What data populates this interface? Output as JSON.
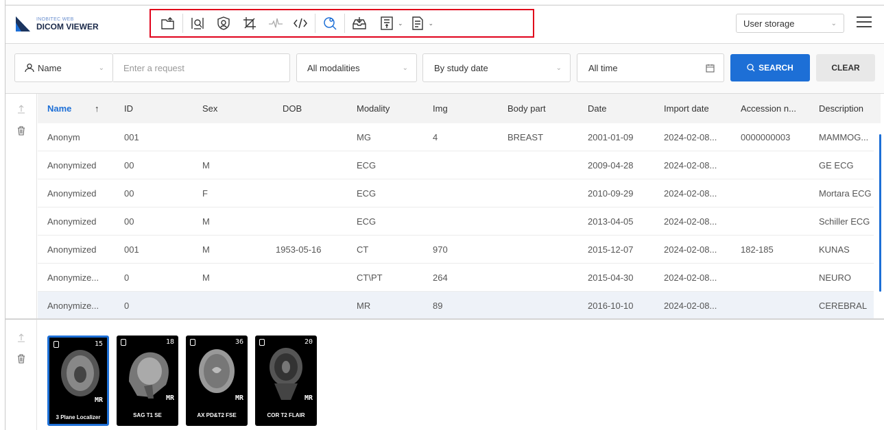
{
  "app": {
    "logo_small": "INOBITEC WEB",
    "logo_big": "DICOM VIEWER",
    "brand_color": "#1d6fd6",
    "highlight_color": "#e0001a"
  },
  "toolbar": {
    "icons": [
      "open-folder-icon",
      "search-image-icon",
      "anonymize-shield-icon",
      "crop-edit-icon",
      "ecg-wave-icon",
      "code-icon",
      "search-settings-icon",
      "download-tray-icon",
      "export-series-icon",
      "report-icon"
    ],
    "caret": "⌄"
  },
  "header": {
    "storage_value": "User storage",
    "caret": "⌄"
  },
  "search": {
    "field_selector": "Name",
    "request_placeholder": "Enter a request",
    "modality_value": "All modalities",
    "date_type_value": "By study date",
    "period_value": "All time",
    "search_label": "SEARCH",
    "clear_label": "CLEAR",
    "caret": "⌄"
  },
  "table": {
    "sort_arrow": "↑",
    "columns": [
      "Name",
      "ID",
      "Sex",
      "DOB",
      "Modality",
      "Img",
      "Body part",
      "Date",
      "Import date",
      "Accession n...",
      "Description"
    ],
    "rows": [
      [
        "Anonym",
        "001",
        "",
        "",
        "MG",
        "4",
        "BREAST",
        "2001-01-09",
        "2024-02-08...",
        "0000000003",
        "MAMMOG..."
      ],
      [
        "Anonymized",
        "00",
        "M",
        "",
        "ECG",
        "",
        "",
        "2009-04-28",
        "2024-02-08...",
        "",
        "GE ECG"
      ],
      [
        "Anonymized",
        "00",
        "F",
        "",
        "ECG",
        "",
        "",
        "2010-09-29",
        "2024-02-08...",
        "",
        "Mortara ECG"
      ],
      [
        "Anonymized",
        "00",
        "M",
        "",
        "ECG",
        "",
        "",
        "2013-04-05",
        "2024-02-08...",
        "",
        "Schiller ECG"
      ],
      [
        "Anonymized",
        "001",
        "M",
        "1953-05-16",
        "CT",
        "970",
        "",
        "2015-12-07",
        "2024-02-08...",
        "182-185",
        "KUNAS"
      ],
      [
        "Anonymize...",
        "0",
        "M",
        "",
        "CT\\PT",
        "264",
        "",
        "2015-04-30",
        "2024-02-08...",
        "",
        "NEURO"
      ],
      [
        "Anonymize...",
        "0",
        "",
        "",
        "MR",
        "89",
        "",
        "2016-10-10",
        "2024-02-08...",
        "",
        "CEREBRAL"
      ]
    ],
    "selected_row": 6
  },
  "series": [
    {
      "label": "3 Plane Localizer",
      "count": "15",
      "modality": "MR",
      "selected": true
    },
    {
      "label": "SAG T1 SE",
      "count": "18",
      "modality": "MR",
      "selected": false
    },
    {
      "label": "AX PD&T2 FSE",
      "count": "36",
      "modality": "MR",
      "selected": false
    },
    {
      "label": "COR T2 FLAIR",
      "count": "20",
      "modality": "MR",
      "selected": false
    }
  ]
}
